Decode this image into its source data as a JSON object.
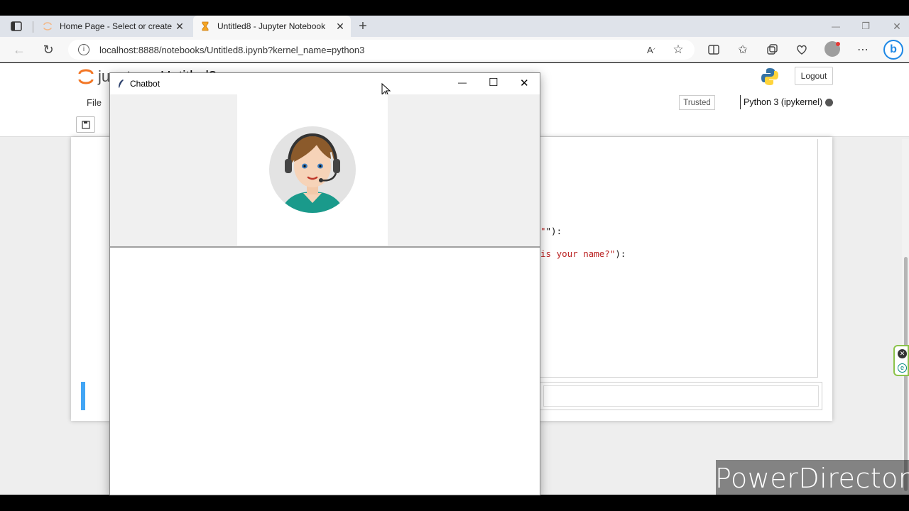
{
  "browser": {
    "tabs": [
      {
        "label": "Home Page - Select or create a n",
        "active": false
      },
      {
        "label": "Untitled8 - Jupyter Notebook",
        "active": true
      }
    ],
    "new_tab": "+",
    "url": "localhost:8888/notebooks/Untitled8.ipynb?kernel_name=python3",
    "window_controls": {
      "minimize": "—",
      "restore": "❐",
      "close": "✕"
    }
  },
  "jupyter": {
    "logo_text": "jupyter",
    "notebook_name": "Untitled8",
    "logout_label": "Logout",
    "menu": {
      "file": "File"
    },
    "trusted_label": "Trusted",
    "kernel_label": "Python 3 (ipykernel)",
    "code_fragments": {
      "line1": "\"):",
      "line2_str": "is your name?\"",
      "line2_end": "):"
    }
  },
  "chatbot": {
    "title": "Chatbot",
    "controls": {
      "minimize": "—",
      "maximize": "☐",
      "close": "✕"
    }
  },
  "watermark": "PowerDirector",
  "colors": {
    "tabbar": "#dfe3ea",
    "accent_blue": "#42a5f5",
    "jupyter_orange": "#f37726",
    "code_string": "#ba2121"
  }
}
